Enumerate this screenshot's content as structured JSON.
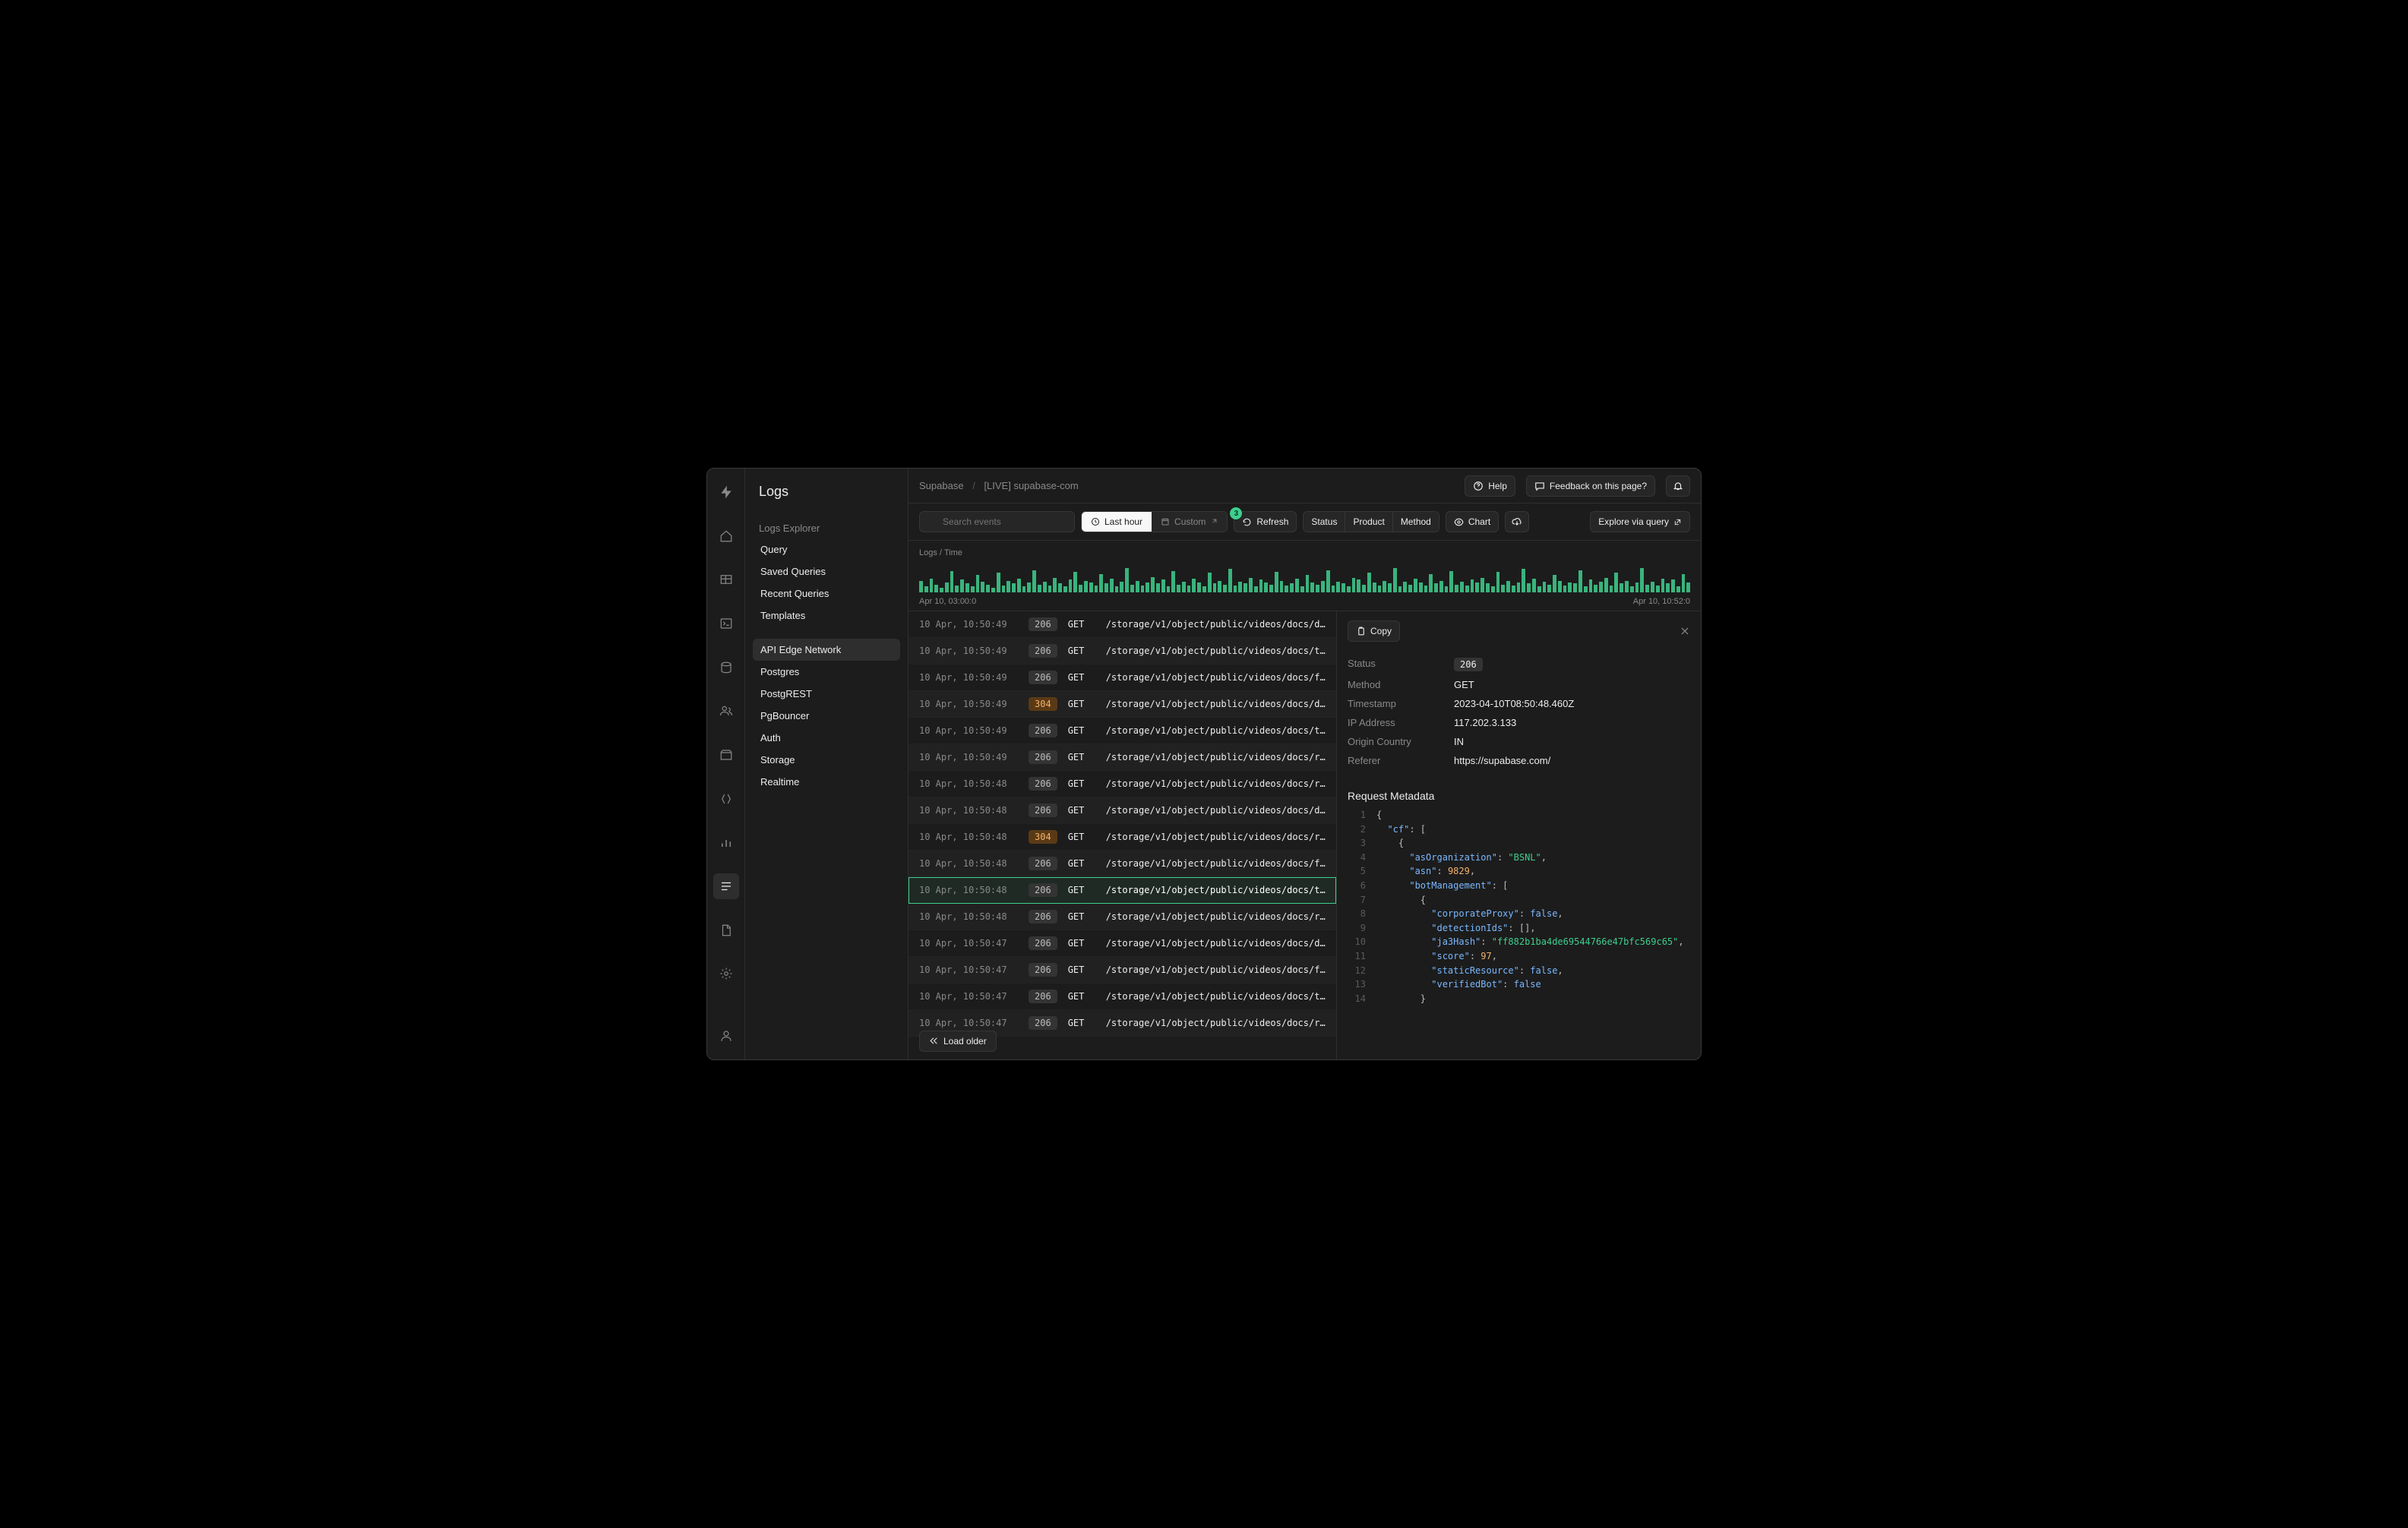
{
  "breadcrumb": {
    "org": "Supabase",
    "project": "[LIVE] supabase-com"
  },
  "topbar": {
    "help": "Help",
    "feedback": "Feedback on this page?"
  },
  "sidebar": {
    "title": "Logs",
    "header": "Logs Explorer",
    "sections": [
      [
        "Query",
        "Saved Queries",
        "Recent Queries",
        "Templates"
      ],
      [
        "API Edge Network",
        "Postgres",
        "PostgREST",
        "PgBouncer",
        "Auth",
        "Storage",
        "Realtime"
      ]
    ],
    "active": "API Edge Network"
  },
  "toolbar": {
    "search_placeholder": "Search events",
    "seg_last_hour": "Last hour",
    "seg_custom": "Custom",
    "refresh_badge": "3",
    "refresh": "Refresh",
    "chips": [
      "Status",
      "Product",
      "Method"
    ],
    "chart_btn": "Chart",
    "explore": "Explore via query"
  },
  "chart": {
    "label": "Logs / Time",
    "start_label": "Apr 10, 03:00:0",
    "end_label": "Apr 10, 10:52:0"
  },
  "chart_data": {
    "type": "bar",
    "xlabel": "Time",
    "ylabel": "Logs",
    "x_range": [
      "Apr 10, 03:00:0",
      "Apr 10, 10:52:0"
    ],
    "note": "minute-level log counts; approximate heights read from sparkline",
    "values": [
      12,
      6,
      14,
      8,
      5,
      10,
      22,
      7,
      13,
      9,
      6,
      18,
      11,
      8,
      5,
      20,
      7,
      12,
      9,
      14,
      6,
      10,
      23,
      8,
      11,
      7,
      15,
      9,
      6,
      13,
      21,
      8,
      12,
      10,
      7,
      19,
      9,
      14,
      6,
      11,
      25,
      8,
      12,
      7,
      10,
      16,
      9,
      13,
      6,
      22,
      8,
      11,
      7,
      14,
      10,
      6,
      20,
      9,
      12,
      8,
      24,
      7,
      11,
      9,
      15,
      6,
      13,
      10,
      8,
      21,
      12,
      7,
      9,
      14,
      6,
      18,
      10,
      8,
      12,
      23,
      7,
      11,
      9,
      6,
      15,
      13,
      8,
      20,
      10,
      7,
      12,
      9,
      25,
      6,
      11,
      8,
      14,
      10,
      7,
      19,
      9,
      12,
      6,
      22,
      8,
      11,
      7,
      13,
      10,
      15,
      9,
      6,
      21,
      8,
      12,
      7,
      10,
      24,
      9,
      14,
      6,
      11,
      8,
      18,
      12,
      7,
      10,
      9,
      23,
      6,
      13,
      8,
      11,
      15,
      7,
      20,
      9,
      12,
      6,
      10,
      25,
      8,
      11,
      7,
      14,
      9,
      13,
      6,
      19,
      10
    ]
  },
  "logs": [
    {
      "ts": "10 Apr, 10:50:49",
      "status": "206",
      "method": "GET",
      "path": "/storage/v1/object/public/videos/docs/du…"
    },
    {
      "ts": "10 Apr, 10:50:49",
      "status": "206",
      "method": "GET",
      "path": "/storage/v1/object/public/videos/docs/to…"
    },
    {
      "ts": "10 Apr, 10:50:49",
      "status": "206",
      "method": "GET",
      "path": "/storage/v1/object/public/videos/docs/fa…"
    },
    {
      "ts": "10 Apr, 10:50:49",
      "status": "304",
      "method": "GET",
      "path": "/storage/v1/object/public/videos/docs/dup…",
      "warn": true
    },
    {
      "ts": "10 Apr, 10:50:49",
      "status": "206",
      "method": "GET",
      "path": "/storage/v1/object/public/videos/docs/to…"
    },
    {
      "ts": "10 Apr, 10:50:49",
      "status": "206",
      "method": "GET",
      "path": "/storage/v1/object/public/videos/docs/re…"
    },
    {
      "ts": "10 Apr, 10:50:48",
      "status": "206",
      "method": "GET",
      "path": "/storage/v1/object/public/videos/docs/re…"
    },
    {
      "ts": "10 Apr, 10:50:48",
      "status": "206",
      "method": "GET",
      "path": "/storage/v1/object/public/videos/docs/du…"
    },
    {
      "ts": "10 Apr, 10:50:48",
      "status": "304",
      "method": "GET",
      "path": "/storage/v1/object/public/videos/docs/rel…",
      "warn": true
    },
    {
      "ts": "10 Apr, 10:50:48",
      "status": "206",
      "method": "GET",
      "path": "/storage/v1/object/public/videos/docs/fa…"
    },
    {
      "ts": "10 Apr, 10:50:48",
      "status": "206",
      "method": "GET",
      "path": "/storage/v1/object/public/videos/docs/to…",
      "selected": true
    },
    {
      "ts": "10 Apr, 10:50:48",
      "status": "206",
      "method": "GET",
      "path": "/storage/v1/object/public/videos/docs/re…"
    },
    {
      "ts": "10 Apr, 10:50:47",
      "status": "206",
      "method": "GET",
      "path": "/storage/v1/object/public/videos/docs/du…"
    },
    {
      "ts": "10 Apr, 10:50:47",
      "status": "206",
      "method": "GET",
      "path": "/storage/v1/object/public/videos/docs/fa…"
    },
    {
      "ts": "10 Apr, 10:50:47",
      "status": "206",
      "method": "GET",
      "path": "/storage/v1/object/public/videos/docs/to…"
    },
    {
      "ts": "10 Apr, 10:50:47",
      "status": "206",
      "method": "GET",
      "path": "/storage/v1/object/public/videos/docs/re…"
    }
  ],
  "load_older": "Load older",
  "detail": {
    "copy": "Copy",
    "fields": [
      {
        "key": "Status",
        "val": "206",
        "pill": true
      },
      {
        "key": "Method",
        "val": "GET"
      },
      {
        "key": "Timestamp",
        "val": "2023-04-10T08:50:48.460Z"
      },
      {
        "key": "IP Address",
        "val": "117.202.3.133"
      },
      {
        "key": "Origin Country",
        "val": "IN"
      },
      {
        "key": "Referer",
        "val": "https://supabase.com/"
      }
    ],
    "metadata_title": "Request Metadata",
    "code_lines": [
      [
        {
          "t": "punc",
          "v": "{"
        }
      ],
      [
        {
          "t": "indent",
          "n": 1
        },
        {
          "t": "key",
          "v": "\"cf\""
        },
        {
          "t": "punc",
          "v": ": ["
        }
      ],
      [
        {
          "t": "indent",
          "n": 2
        },
        {
          "t": "punc",
          "v": "{"
        }
      ],
      [
        {
          "t": "indent",
          "n": 3
        },
        {
          "t": "key",
          "v": "\"asOrganization\""
        },
        {
          "t": "punc",
          "v": ": "
        },
        {
          "t": "str",
          "v": "\"BSNL\""
        },
        {
          "t": "punc",
          "v": ","
        }
      ],
      [
        {
          "t": "indent",
          "n": 3
        },
        {
          "t": "key",
          "v": "\"asn\""
        },
        {
          "t": "punc",
          "v": ": "
        },
        {
          "t": "num",
          "v": "9829"
        },
        {
          "t": "punc",
          "v": ","
        }
      ],
      [
        {
          "t": "indent",
          "n": 3
        },
        {
          "t": "key",
          "v": "\"botManagement\""
        },
        {
          "t": "punc",
          "v": ": ["
        }
      ],
      [
        {
          "t": "indent",
          "n": 4
        },
        {
          "t": "punc",
          "v": "{"
        }
      ],
      [
        {
          "t": "indent",
          "n": 5
        },
        {
          "t": "key",
          "v": "\"corporateProxy\""
        },
        {
          "t": "punc",
          "v": ": "
        },
        {
          "t": "bool",
          "v": "false"
        },
        {
          "t": "punc",
          "v": ","
        }
      ],
      [
        {
          "t": "indent",
          "n": 5
        },
        {
          "t": "key",
          "v": "\"detectionIds\""
        },
        {
          "t": "punc",
          "v": ": [],"
        }
      ],
      [
        {
          "t": "indent",
          "n": 5
        },
        {
          "t": "key",
          "v": "\"ja3Hash\""
        },
        {
          "t": "punc",
          "v": ": "
        },
        {
          "t": "str",
          "v": "\"ff882b1ba4de69544766e47bfc569c65\""
        },
        {
          "t": "punc",
          "v": ","
        }
      ],
      [
        {
          "t": "indent",
          "n": 5
        },
        {
          "t": "key",
          "v": "\"score\""
        },
        {
          "t": "punc",
          "v": ": "
        },
        {
          "t": "num",
          "v": "97"
        },
        {
          "t": "punc",
          "v": ","
        }
      ],
      [
        {
          "t": "indent",
          "n": 5
        },
        {
          "t": "key",
          "v": "\"staticResource\""
        },
        {
          "t": "punc",
          "v": ": "
        },
        {
          "t": "bool",
          "v": "false"
        },
        {
          "t": "punc",
          "v": ","
        }
      ],
      [
        {
          "t": "indent",
          "n": 5
        },
        {
          "t": "key",
          "v": "\"verifiedBot\""
        },
        {
          "t": "punc",
          "v": ": "
        },
        {
          "t": "bool",
          "v": "false"
        }
      ],
      [
        {
          "t": "indent",
          "n": 4
        },
        {
          "t": "punc",
          "v": "}"
        }
      ]
    ]
  }
}
